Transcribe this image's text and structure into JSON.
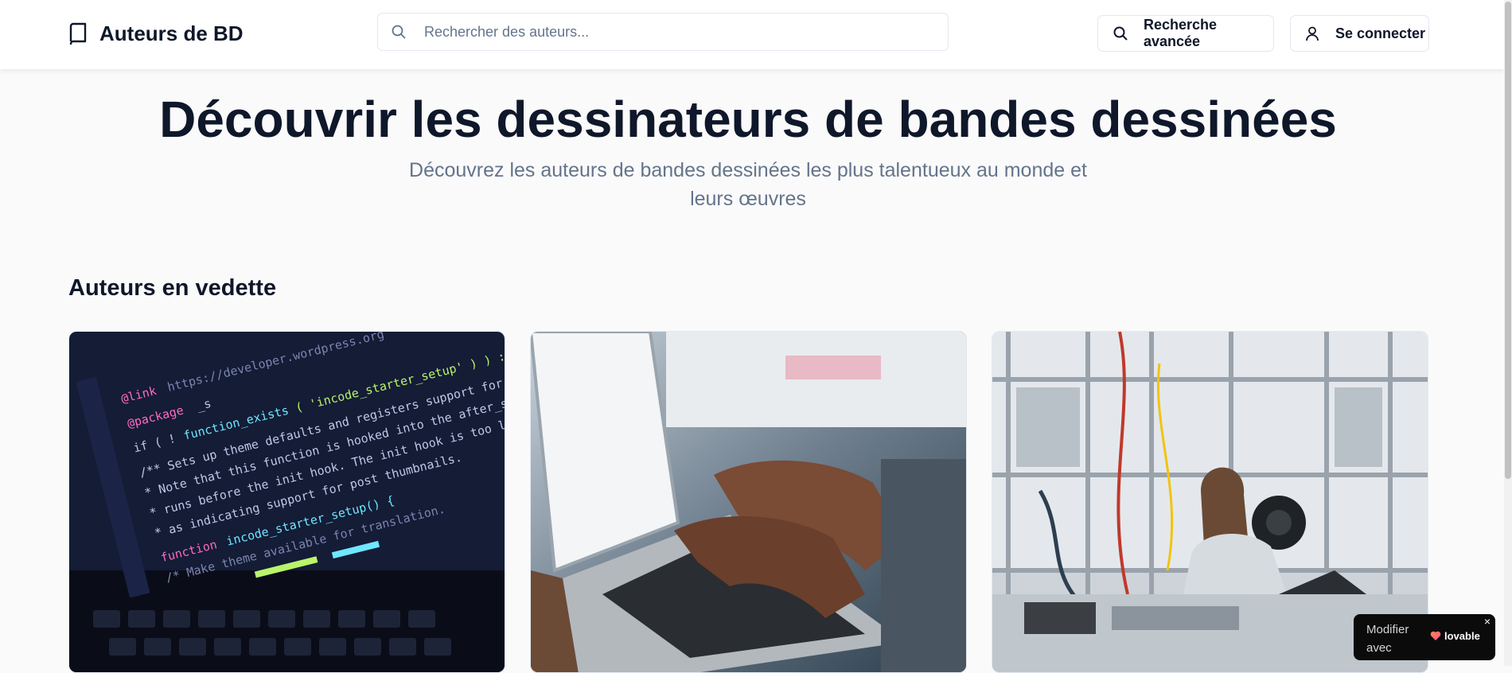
{
  "header": {
    "logo_text": "Auteurs de BD",
    "search_placeholder": "Rechercher des auteurs...",
    "advanced_search_label": "Recherche avancée",
    "login_label": "Se connecter"
  },
  "hero": {
    "title": "Découvrir les dessinateurs de bandes dessinées",
    "subtitle": "Découvrez les auteurs de bandes dessinées les plus talentueux au monde et leurs œuvres"
  },
  "featured": {
    "title": "Auteurs en vedette",
    "cards": [
      {
        "image": "code-on-laptop-screen"
      },
      {
        "image": "hands-typing-on-laptop"
      },
      {
        "image": "woman-working-in-lab"
      }
    ]
  },
  "badge": {
    "text": "Modifier avec",
    "brand": "lovable",
    "close": "×"
  },
  "colors": {
    "text": "#0f172a",
    "muted": "#64748b",
    "border": "#e2e8f0",
    "background": "#fafafa"
  }
}
